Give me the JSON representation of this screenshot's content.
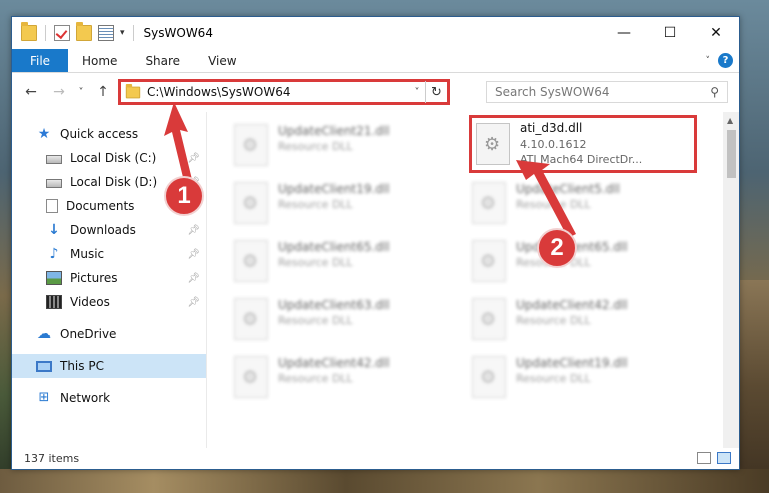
{
  "window": {
    "title": "SysWOW64",
    "controls": {
      "minimize": "—",
      "maximize": "☐",
      "close": "✕"
    }
  },
  "ribbon": {
    "tabs": [
      "File",
      "Home",
      "Share",
      "View"
    ],
    "help": "?"
  },
  "navbar": {
    "back": "←",
    "forward": "→",
    "recent": "˅",
    "up": "↑",
    "address": "C:\\Windows\\SysWOW64",
    "refresh": "↻",
    "search_placeholder": "Search SysWOW64"
  },
  "sidebar": {
    "items": [
      {
        "label": "Quick access",
        "icon": "star-icon"
      },
      {
        "label": "Local Disk (C:)",
        "icon": "drive-icon",
        "pinned": true
      },
      {
        "label": "Local Disk (D:)",
        "icon": "drive-icon",
        "pinned": true
      },
      {
        "label": "Documents",
        "icon": "documents-icon",
        "pinned": true
      },
      {
        "label": "Downloads",
        "icon": "downloads-icon",
        "pinned": true
      },
      {
        "label": "Music",
        "icon": "music-icon",
        "pinned": true
      },
      {
        "label": "Pictures",
        "icon": "pictures-icon",
        "pinned": true
      },
      {
        "label": "Videos",
        "icon": "videos-icon",
        "pinned": true
      },
      {
        "label": "OneDrive",
        "icon": "onedrive-icon"
      },
      {
        "label": "This PC",
        "icon": "this-pc-icon",
        "selected": true
      },
      {
        "label": "Network",
        "icon": "network-icon"
      }
    ]
  },
  "files": {
    "left_column": [
      {
        "name": "UpdateClient21.dll",
        "type": "Resource DLL"
      },
      {
        "name": "UpdateClient19.dll",
        "type": "Resource DLL"
      },
      {
        "name": "UpdateClient65.dll",
        "type": "Resource DLL"
      },
      {
        "name": "UpdateClient63.dll",
        "type": "Resource DLL"
      },
      {
        "name": "UpdateClient42.dll",
        "type": "Resource DLL"
      }
    ],
    "right_column": [
      {
        "name": "ati_d3d.dll",
        "version": "4.10.0.1612",
        "type": "ATI Mach64 DirectDr...",
        "highlighted": true
      },
      {
        "name": "UpdateClient5.dll",
        "type": "Resource DLL"
      },
      {
        "name": "UpdateClient65.dll",
        "type": "Resource DLL"
      },
      {
        "name": "UpdateClient42.dll",
        "type": "Resource DLL"
      },
      {
        "name": "UpdateClient19.dll",
        "type": "Resource DLL"
      }
    ]
  },
  "status": {
    "item_count": "137 items"
  },
  "annotations": {
    "step1": "1",
    "step2": "2"
  },
  "colors": {
    "accent": "#1979ca",
    "annotation_red": "#d93a3a",
    "selected_bg": "#cce4f7"
  }
}
